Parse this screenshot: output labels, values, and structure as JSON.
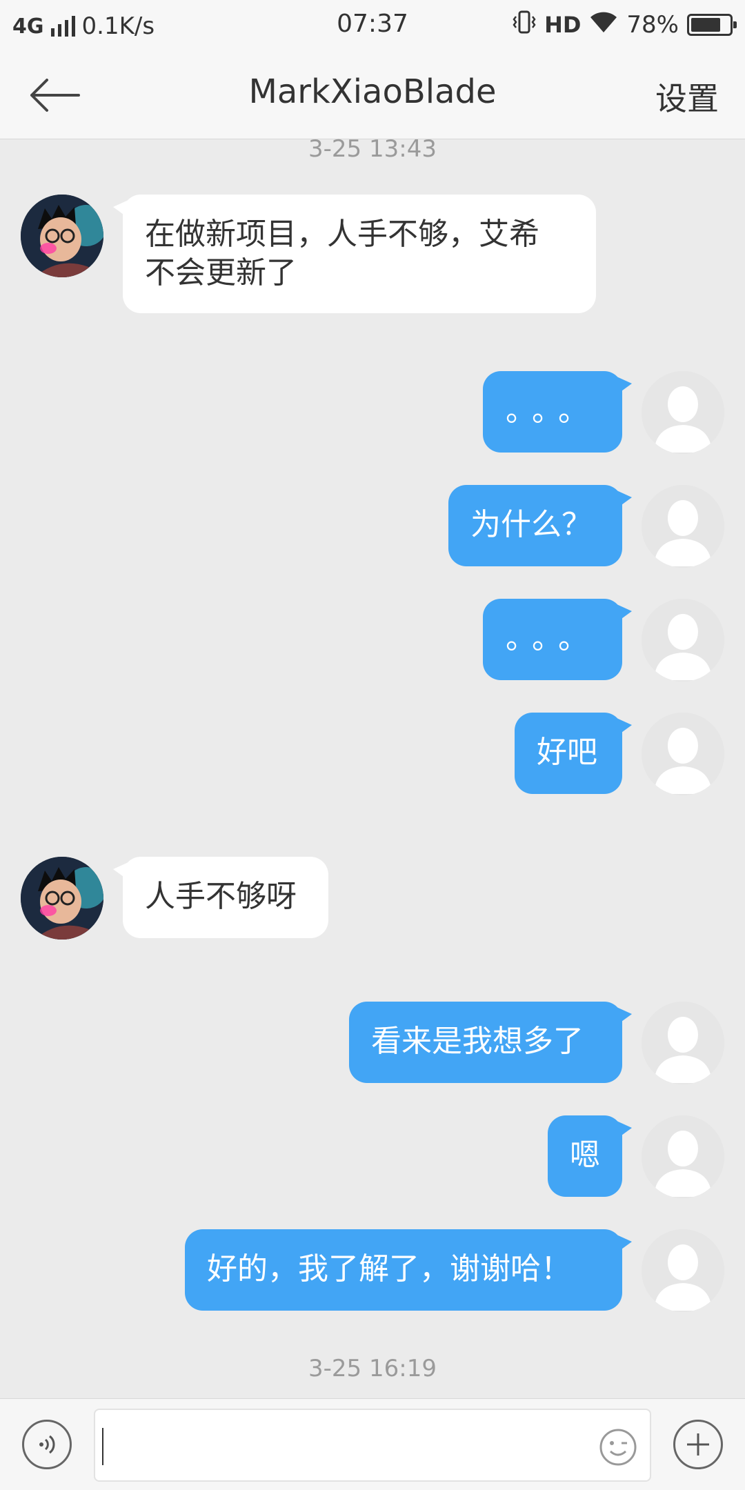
{
  "status_bar": {
    "network": "4G",
    "speed": "0.1K/s",
    "time": "07:37",
    "hd": "HD",
    "battery": "78%",
    "battery_level": 0.78
  },
  "header": {
    "title": "MarkXiaoBlade",
    "settings_label": "设置"
  },
  "chat": {
    "timestamp_1": "3-25 13:43",
    "timestamp_2": "3-25 16:19",
    "messages": [
      {
        "side": "in",
        "text": "在做新项目，人手不够，艾希\n不会更新了"
      },
      {
        "side": "out",
        "text": "。。。"
      },
      {
        "side": "out",
        "text": "为什么？"
      },
      {
        "side": "out",
        "text": "。。。"
      },
      {
        "side": "out",
        "text": "好吧"
      },
      {
        "side": "in",
        "text": "人手不够呀"
      },
      {
        "side": "out",
        "text": "看来是我想多了"
      },
      {
        "side": "out",
        "text": "嗯"
      },
      {
        "side": "out",
        "text": "好的，我了解了，谢谢哈！"
      }
    ]
  },
  "colors": {
    "outgoing_bubble": "#42a5f5",
    "incoming_bubble": "#ffffff",
    "background": "#ebebeb"
  },
  "icons": {
    "back": "back-arrow-icon",
    "voice": "voice-icon",
    "emoji": "emoji-icon",
    "plus": "plus-icon"
  }
}
